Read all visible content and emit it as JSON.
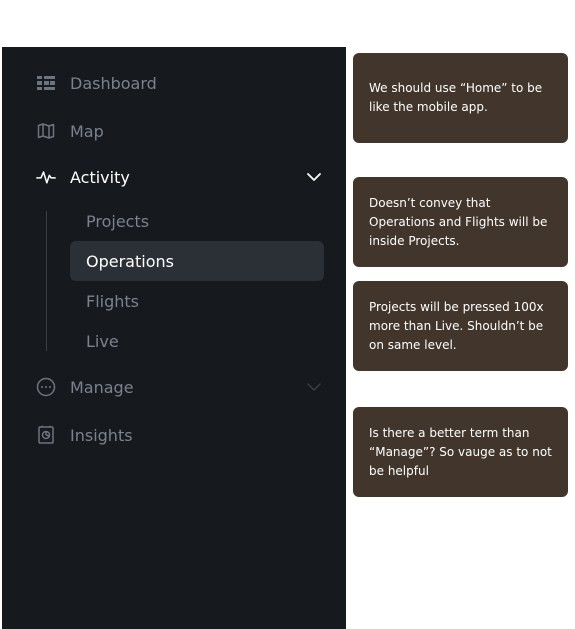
{
  "nav": {
    "dashboard": "Dashboard",
    "map": "Map",
    "activity": "Activity",
    "activity_children": {
      "projects": "Projects",
      "operations": "Operations",
      "flights": "Flights",
      "live": "Live"
    },
    "manage": "Manage",
    "insights": "Insights"
  },
  "icons": {
    "dashboard": "grid-list-icon",
    "map": "map-icon",
    "activity": "pulse-icon",
    "manage": "ellipsis-circle-icon",
    "insights": "report-chart-icon",
    "expand": "chevron-down-icon"
  },
  "comments": [
    "We should use “Home” to be like the mobile app.",
    "Doesn’t convey that Operations and Flights will be inside Projects.",
    "Projects will be pressed 100x more than Live. Shouldn’t be on same level.",
    "Is there a better term than “Manage”? So vauge as to not be helpful"
  ],
  "colors": {
    "sidebar_bg": "#16191e",
    "selected_bg": "#2b2f36",
    "muted_text": "#7c828c",
    "active_text": "#ffffff",
    "comment_bg": "#42362c"
  }
}
